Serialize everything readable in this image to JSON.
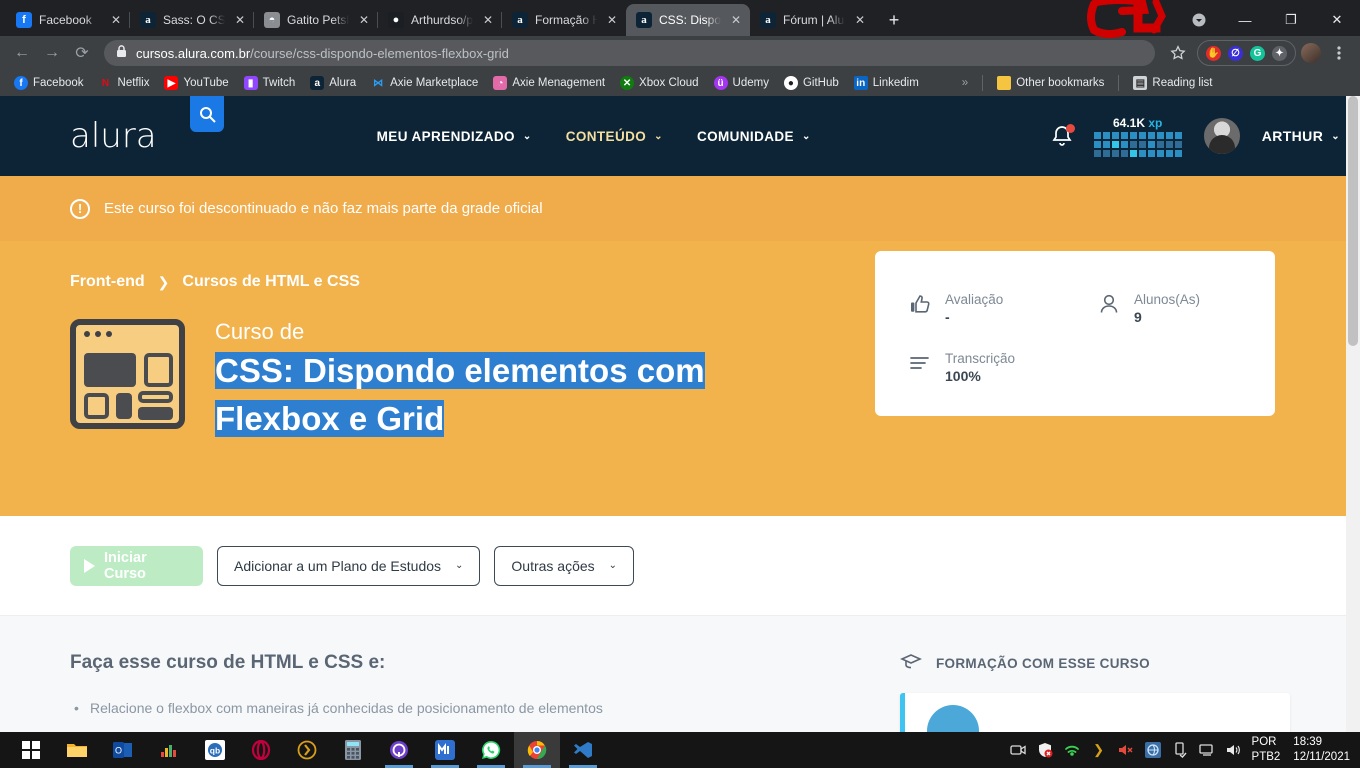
{
  "browser": {
    "tabs": [
      {
        "title": "Facebook",
        "favicon": "facebook-icon",
        "active": false
      },
      {
        "title": "Sass: O CSS com",
        "favicon": "alura-icon",
        "active": false
      },
      {
        "title": "Gatito Petshop",
        "favicon": "globe-icon",
        "active": false
      },
      {
        "title": "Arthurdso/projet",
        "favicon": "github-icon",
        "active": false
      },
      {
        "title": "Formação HTML",
        "favicon": "alura-icon",
        "active": false
      },
      {
        "title": "CSS: Dispondo el",
        "favicon": "alura-icon",
        "active": true
      },
      {
        "title": "Fórum | Alura - C",
        "favicon": "alura-icon",
        "active": false
      }
    ],
    "new_tab_label": "+",
    "close_tab_label": "✕",
    "window_minimize": "—",
    "window_maximize": "❐",
    "window_close": "✕",
    "nav": {
      "back": "←",
      "forward": "→",
      "reload": "⟳"
    },
    "address": {
      "lock": "🔒",
      "host": "cursos.alura.com.br",
      "path": "/course/css-dispondo-elementos-flexbox-grid"
    },
    "toolbar_icons": [
      "star-icon",
      "adblock-extension-icon",
      "blue-extension-icon",
      "grammarly-extension-icon",
      "puzzle-extensions-icon",
      "profile-avatar",
      "chrome-menu-icon"
    ],
    "bookmarks": [
      {
        "label": "Facebook",
        "icon": "facebook-icon"
      },
      {
        "label": "Netflix",
        "icon": "netflix-icon"
      },
      {
        "label": "YouTube",
        "icon": "youtube-icon"
      },
      {
        "label": "Twitch",
        "icon": "twitch-icon"
      },
      {
        "label": "Alura",
        "icon": "alura-icon"
      },
      {
        "label": "Axie Marketplace",
        "icon": "axie-icon"
      },
      {
        "label": "Axie Menagement",
        "icon": "axie-mgmt-icon"
      },
      {
        "label": "Xbox Cloud",
        "icon": "xbox-icon"
      },
      {
        "label": "Udemy",
        "icon": "udemy-icon"
      },
      {
        "label": "GitHub",
        "icon": "github-icon"
      },
      {
        "label": "Linkedim",
        "icon": "linkedin-icon"
      }
    ],
    "bookmarks_overflow": "»",
    "other_bookmarks": "Other bookmarks",
    "reading_list": "Reading list"
  },
  "site": {
    "logo": "alura",
    "search_icon": "search-icon",
    "nav": [
      {
        "label": "MEU APRENDIZADO",
        "chevron": "⌄"
      },
      {
        "label": "CONTEÚDO",
        "chevron": "⌄"
      },
      {
        "label": "COMUNIDADE",
        "chevron": "⌄"
      }
    ],
    "bell_icon": "notification-bell-icon",
    "xp": {
      "amount": "64.1K",
      "unit": "xp"
    },
    "user": {
      "name": "ARTHUR",
      "chevron": "⌄"
    },
    "colors": {
      "header_bg": "#0d2436",
      "hero_bg": "#f2b24c",
      "notice_bg": "#f0ab4b",
      "selection_blue": "#2f7fd1",
      "accent_blue": "#27b4e5"
    }
  },
  "notice": {
    "icon": "alert-icon",
    "text": "Este curso foi descontinuado e não faz mais parte da grade oficial"
  },
  "breadcrumb": {
    "items": [
      "Front-end",
      "Cursos de HTML e CSS"
    ],
    "separator": "❯"
  },
  "course": {
    "thumbnail": "course-layout-thumbnail",
    "pretitle": "Curso de",
    "title_line1": "CSS: Dispondo elementos com",
    "title_line2": "Flexbox e Grid",
    "stats": [
      {
        "icon": "thumbs-up-icon",
        "label": "Avaliação",
        "value": "-"
      },
      {
        "icon": "person-icon",
        "label": "Alunos(As)",
        "value": "9"
      },
      {
        "icon": "transcript-lines-icon",
        "label": "Transcrição",
        "value": "100%"
      }
    ]
  },
  "actions": {
    "start": {
      "label": "Iniciar Curso",
      "icon": "play-icon"
    },
    "plan": {
      "label": "Adicionar a um Plano de Estudos",
      "chevron": "⌄"
    },
    "other": {
      "label": "Outras ações",
      "chevron": "⌄"
    }
  },
  "content": {
    "section_title": "Faça esse curso de HTML e CSS e:",
    "bullets": [
      "Relacione o flexbox com maneiras já conhecidas de posicionamento de elementos"
    ],
    "sidebar_title": "FORMAÇÃO COM ESSE CURSO",
    "sidebar_icon": "graduation-cap-icon"
  },
  "taskbar": {
    "items": [
      {
        "icon": "windows-start-icon",
        "running": false
      },
      {
        "icon": "file-explorer-icon",
        "running": false
      },
      {
        "icon": "outlook-icon",
        "running": false
      },
      {
        "icon": "equalizer-icon",
        "running": false
      },
      {
        "icon": "qbittorrent-icon",
        "running": false
      },
      {
        "icon": "opera-gx-icon",
        "running": false
      },
      {
        "icon": "yandex-icon",
        "running": false
      },
      {
        "icon": "calculator-icon",
        "running": false
      },
      {
        "icon": "github-desktop-icon",
        "running": true
      },
      {
        "icon": "mega-icon",
        "running": true
      },
      {
        "icon": "whatsapp-icon",
        "running": true
      },
      {
        "icon": "chrome-icon",
        "running": true,
        "active": true
      },
      {
        "icon": "vscode-icon",
        "running": true
      }
    ],
    "tray": [
      "camera-icon",
      "antivirus-icon",
      "wifi-signal-icon",
      "opera-arrow-icon",
      "volume-mute-icon",
      "network-globe-icon",
      "usb-eject-icon",
      "display-icon",
      "speaker-icon"
    ],
    "language_line1": "POR",
    "language_line2": "PTB2",
    "time": "18:39",
    "date": "12/11/2021"
  }
}
